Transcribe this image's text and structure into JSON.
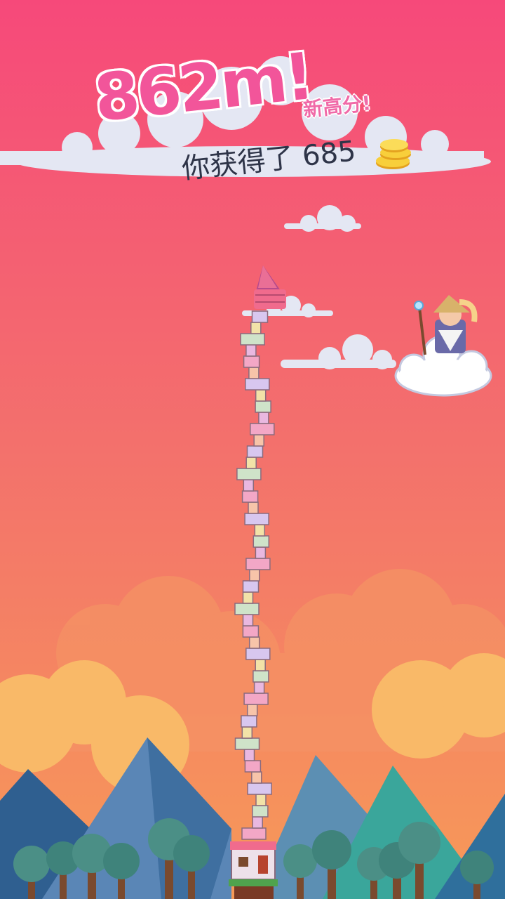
{
  "hud": {
    "height_score": "862m!",
    "new_highscore_label": "新高分!",
    "coins_earned_text": "你获得了 685"
  },
  "icons": {
    "coin": "coin-stack-icon",
    "wizard": "wizard-on-cloud-icon",
    "tower_top": "tower-roof-icon",
    "tower_base": "house-base-icon"
  },
  "colors": {
    "sky_top": "#f6497a",
    "sky_bottom": "#f7a05a",
    "score_pink": "#f2559a",
    "cloud_white": "#e4e7f3",
    "mountain_blue": "#3b6e9c",
    "mountain_teal": "#3aa69b",
    "tree_green": "#4b8f86"
  }
}
